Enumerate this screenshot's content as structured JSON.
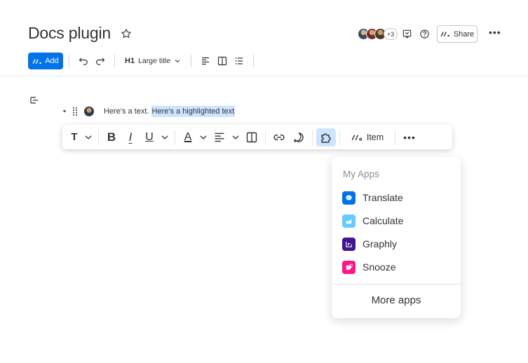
{
  "page": {
    "title": "Docs plugin"
  },
  "header": {
    "avatar_extra_count": "+3",
    "share_label": "Share"
  },
  "toolbar": {
    "add_label": "Add",
    "heading_marker": "H1",
    "heading_value": "Large title"
  },
  "document": {
    "plain_text": "Here's a text. ",
    "highlighted_text": "Here's a highlighted text"
  },
  "format_bar": {
    "text_type_label": "T",
    "bold_label": "B",
    "italic_label": "I",
    "underline_label": "U",
    "color_label": "A",
    "item_label": "Item"
  },
  "apps_menu": {
    "heading": "My Apps",
    "apps": [
      {
        "label": "Translate",
        "color": "#0073ea",
        "icon": "chat-bubble-icon"
      },
      {
        "label": "Calculate",
        "color": "#66ccff",
        "icon": "chart-icon"
      },
      {
        "label": "Graphly",
        "color": "#401694",
        "icon": "graph-icon"
      },
      {
        "label": "Snooze",
        "color": "#ff158a",
        "icon": "snooze-icon"
      }
    ],
    "more_label": "More apps"
  },
  "colors": {
    "accent": "#0073ea",
    "highlight": "#cce5ff",
    "text": "#323338"
  }
}
